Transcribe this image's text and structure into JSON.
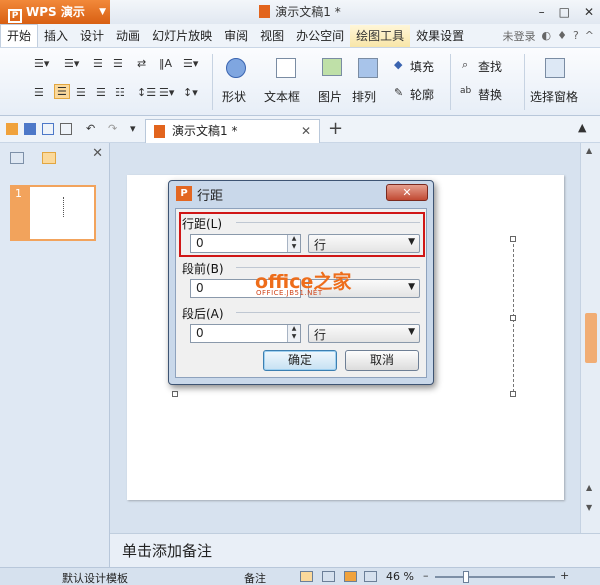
{
  "titlebar": {
    "app_name": "WPS 演示",
    "doc_title": "演示文稿1 *",
    "window_controls": [
      "–",
      "□",
      "✕"
    ]
  },
  "menubar": {
    "items": [
      "开始",
      "插入",
      "设计",
      "动画",
      "幻灯片放映",
      "审阅",
      "视图",
      "办公空间",
      "绘图工具",
      "效果设置"
    ],
    "active": "开始",
    "login": "未登录"
  },
  "ribbon": {
    "shape": "形状",
    "textbox": "文本框",
    "picture": "图片",
    "arrange": "排列",
    "fill": "填充",
    "outline": "轮廓",
    "find": "查找",
    "replace": "替换",
    "selection_pane": "选择窗格"
  },
  "tabs": {
    "doc_tab": "演示文稿1 *",
    "close": "✕",
    "new_tab": "+"
  },
  "left_panel": {
    "slide_number": "1",
    "close": "✕"
  },
  "notes": {
    "placeholder": "单击添加备注"
  },
  "statusbar": {
    "template": "默认设计模板",
    "notes": "备注",
    "zoom": "46 %",
    "zoom_level": 0.46
  },
  "dialog": {
    "title": "行距",
    "close": "✕",
    "line_spacing": {
      "label": "行距(L)",
      "value": "0",
      "unit": "行"
    },
    "before": {
      "label": "段前(B)",
      "value": "0",
      "unit": "行"
    },
    "after": {
      "label": "段后(A)",
      "value": "0",
      "unit": "行"
    },
    "ok": "确定",
    "cancel": "取消"
  },
  "watermark": {
    "main": "office之家",
    "sub": "OFFICE.JB51.NET"
  }
}
